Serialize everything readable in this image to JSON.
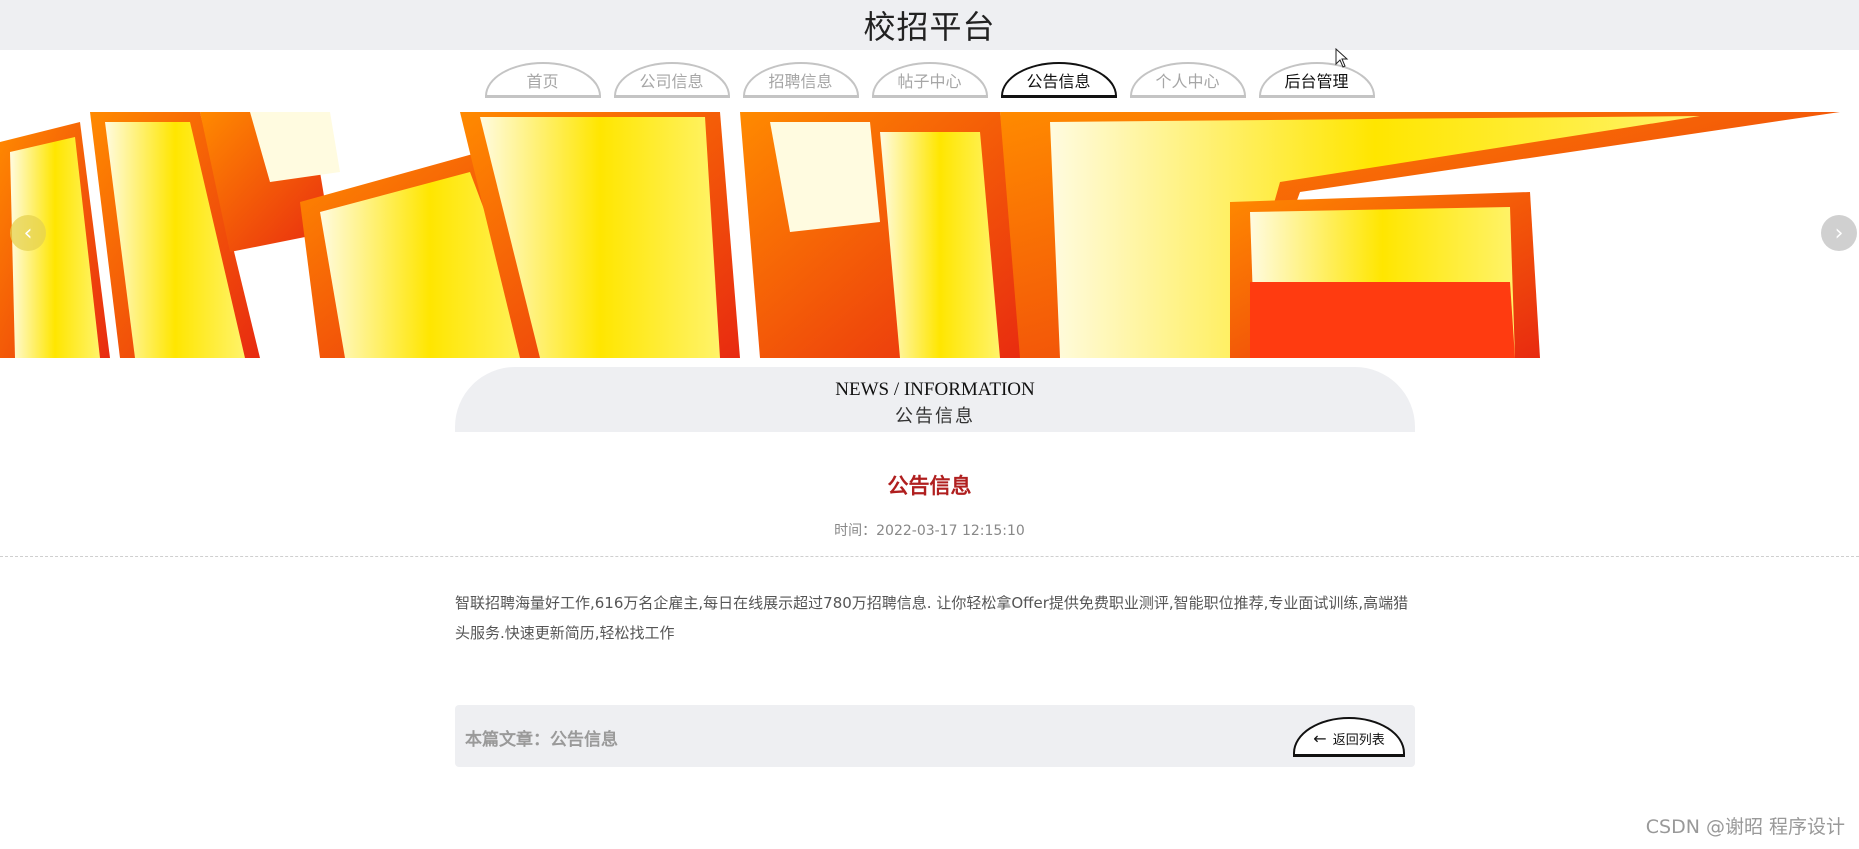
{
  "header": {
    "title": "校招平台"
  },
  "nav": {
    "tabs": [
      {
        "label": "首页"
      },
      {
        "label": "公司信息"
      },
      {
        "label": "招聘信息"
      },
      {
        "label": "帖子中心"
      },
      {
        "label": "公告信息"
      },
      {
        "label": "个人中心"
      },
      {
        "label": "后台管理"
      }
    ],
    "active_tab": "公告信息"
  },
  "banner": {
    "left_arrow_icon": "chevron-left-icon",
    "right_arrow_icon": "chevron-right-icon"
  },
  "section": {
    "title_en": "NEWS / INFORMATION",
    "title_cn": "公告信息"
  },
  "article": {
    "title": "公告信息",
    "time": "时间：2022-03-17 12:15:10",
    "body": "智联招聘海量好工作,616万名企雇主,每日在线展示超过780万招聘信息. 让你轻松拿Offer提供免费职业测评,智能职位推荐,专业面试训练,高端猎头服务.快速更新简历,轻松找工作"
  },
  "footer": {
    "current_article": "本篇文章：公告信息",
    "back_label": "返回列表",
    "back_icon": "arrow-left-icon"
  },
  "watermark": "CSDN @谢昭  程序设计",
  "colors": {
    "accent_red": "#b01f1f",
    "panel_gray": "#eeeff2"
  }
}
